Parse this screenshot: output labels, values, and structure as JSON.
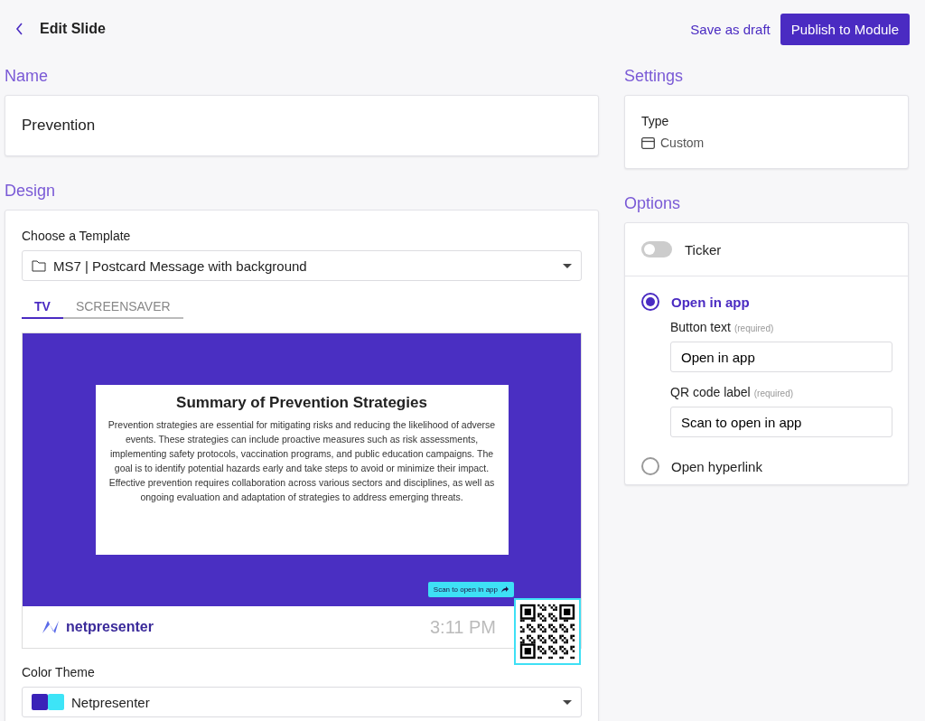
{
  "header": {
    "title": "Edit Slide",
    "save_draft": "Save as draft",
    "publish": "Publish to Module"
  },
  "name_section": {
    "heading": "Name",
    "value": "Prevention"
  },
  "design": {
    "heading": "Design",
    "template_label": "Choose a Template",
    "template_value": "MS7 | Postcard Message with background",
    "tabs": [
      {
        "label": "TV",
        "selected": true
      },
      {
        "label": "SCREENSAVER",
        "selected": false
      }
    ],
    "preview": {
      "title": "Summary of Prevention Strategies",
      "body": "Prevention strategies are essential for mitigating risks and reducing the likelihood of adverse events. These strategies can include proactive measures such as risk assessments, implementing safety protocols, vaccination programs, and public education campaigns. The goal is to identify potential hazards early and take steps to avoid or minimize their impact. Effective prevention requires collaboration across various sectors and disciplines, as well as ongoing evaluation and adaptation of strategies to address emerging threats.",
      "qr_label": "Scan to open in app",
      "brand": "netpresenter",
      "time": "3:11 PM"
    },
    "color_theme_label": "Color Theme",
    "color_theme_value": "Netpresenter"
  },
  "settings": {
    "heading": "Settings",
    "type_label": "Type",
    "type_value": "Custom"
  },
  "options": {
    "heading": "Options",
    "ticker": {
      "label": "Ticker",
      "on": false
    },
    "choices": [
      {
        "label": "Open in app",
        "selected": true,
        "fields": [
          {
            "label": "Button text",
            "hint": "(required)",
            "value": "Open in app"
          },
          {
            "label": "QR code label",
            "hint": "(required)",
            "value": "Scan to open in app"
          }
        ]
      },
      {
        "label": "Open hyperlink",
        "selected": false
      }
    ]
  }
}
